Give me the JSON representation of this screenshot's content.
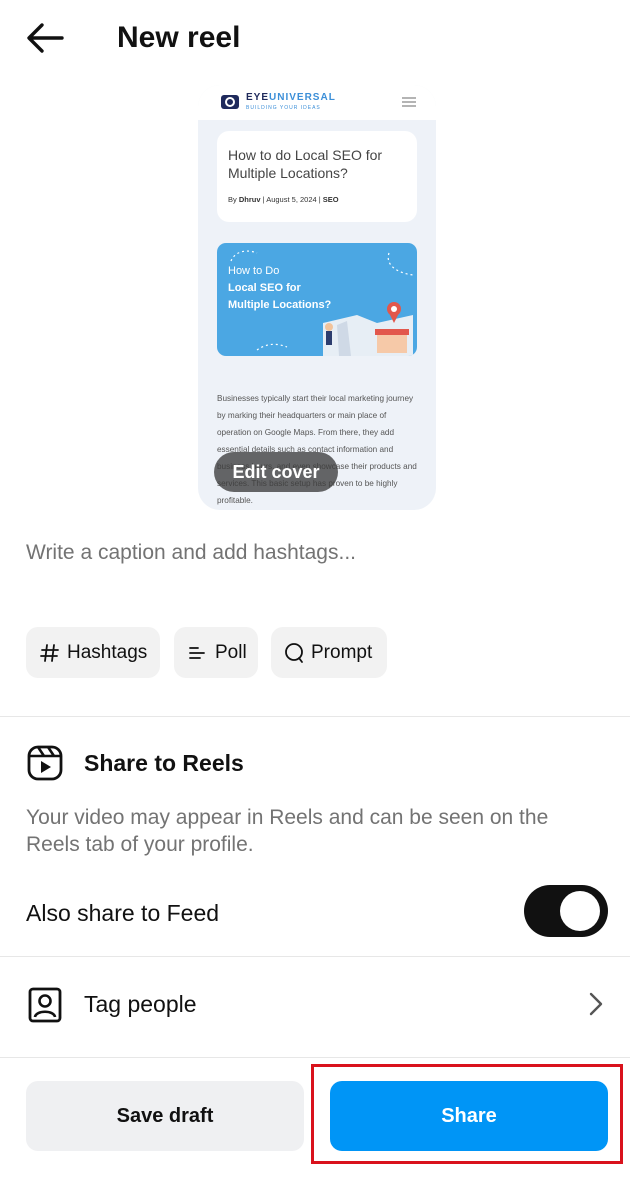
{
  "header": {
    "title": "New reel",
    "back_icon": "arrow-left-icon"
  },
  "preview": {
    "brand_main": "EYE",
    "brand_accent": "UNIVERSAL",
    "tagline": "BUILDING YOUR IDEAS",
    "article_title": "How to do Local SEO for Multiple Locations?",
    "meta_prefix": "By ",
    "author": "Dhruv",
    "meta_date": " | August 5, 2024 | ",
    "category": "SEO",
    "banner_line1": "How to Do",
    "banner_line2": "Local SEO for",
    "banner_line3": "Multiple Locations?",
    "body_text": "Businesses typically start their local marketing journey by marking their headquarters or main place of operation on Google Maps. From there, they add essential details such as contact information and business hours, and even showcase their products and services. This basic setup has proven to be highly profitable.",
    "edit_cover_label": "Edit cover"
  },
  "caption": {
    "placeholder": "Write a caption and add hashtags..."
  },
  "chips": [
    {
      "label": "Hashtags",
      "icon": "hashtag-icon"
    },
    {
      "label": "Poll",
      "icon": "poll-icon"
    },
    {
      "label": "Prompt",
      "icon": "prompt-icon"
    }
  ],
  "share_to_reels": {
    "title": "Share to Reels",
    "icon": "reels-icon",
    "description": "Your video may appear in Reels and can be seen on the Reels tab of your profile.",
    "also_share_label": "Also share to Feed",
    "also_share_enabled": true
  },
  "tag_people": {
    "label": "Tag people",
    "icon": "tag-person-icon"
  },
  "footer": {
    "save_draft_label": "Save draft",
    "share_label": "Share"
  },
  "colors": {
    "share_blue": "#0095f6",
    "highlight_red": "#d9121c",
    "toggle_on": "#111111"
  }
}
